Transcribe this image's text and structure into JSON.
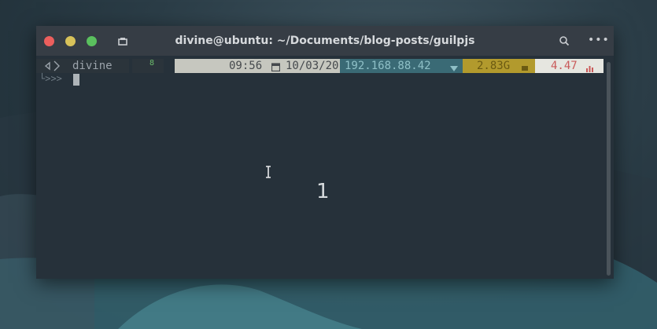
{
  "window": {
    "title": "divine@ubuntu: ~/Documents/blog-posts/guilpjs"
  },
  "colors": {
    "close": "#ec5f5d",
    "minimize": "#d8c25a",
    "maximize": "#5ac05e",
    "terminal_bg": "#26313a",
    "titlebar_bg": "#363d45"
  },
  "titlebar": {
    "tab_icon": "terminal-tab-icon",
    "search_icon": "search-icon",
    "menu_label": "•••"
  },
  "prompt": {
    "user": "divine",
    "git_count": "8",
    "time": "09:56",
    "date": "10/03/20",
    "ip": "192.168.88.42",
    "memory": "2.83G",
    "load": "4.47",
    "second_line": "└>>>"
  },
  "overlay": {
    "number": "1"
  }
}
